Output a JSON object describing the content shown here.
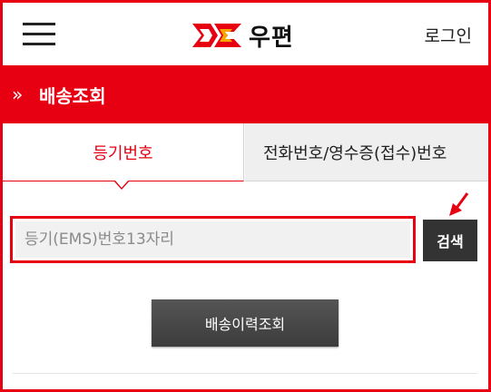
{
  "header": {
    "logo_text": "우편",
    "login_label": "로그인"
  },
  "titlebar": {
    "chevron": "»",
    "title": "배송조회"
  },
  "tabs": [
    {
      "label": "등기번호",
      "active": true
    },
    {
      "label": "전화번호/영수증(접수)번호",
      "active": false
    }
  ],
  "search": {
    "placeholder": "등기(EMS)번호13자리",
    "value": "",
    "button_label": "검색"
  },
  "history_button_label": "배송이력조회",
  "colors": {
    "accent": "#e60012",
    "dark_button": "#333333"
  },
  "icons": [
    "menu-icon",
    "post-logo-icon",
    "chevron-right-icon",
    "arrow-pointer-icon"
  ]
}
